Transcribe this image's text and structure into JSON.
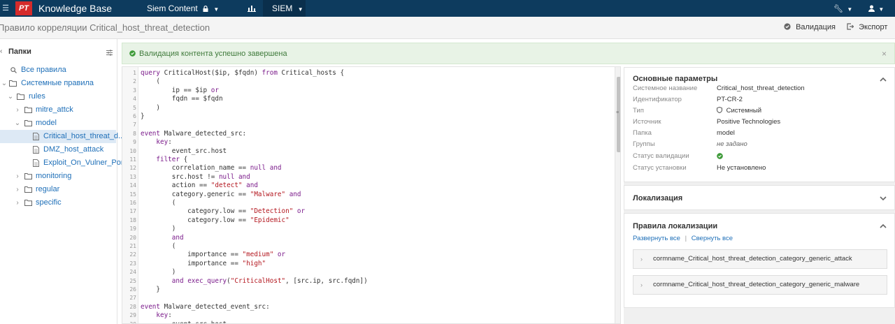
{
  "topbar": {
    "menu_icon": "hamburger-icon",
    "logo_text": "PT",
    "brand": "Knowledge Base",
    "nav_siem_content": "Siem Content",
    "nav_siem": "SIEM",
    "colors": {
      "bg": "#0d3b5e",
      "logo": "#d52b2b"
    }
  },
  "titlebar": {
    "title": "Правило корреляции Critical_host_threat_detection",
    "validate_label": "Валидация",
    "export_label": "Экспорт"
  },
  "sidebar": {
    "title": "Папки",
    "items": [
      {
        "label": "Все правила"
      },
      {
        "label": "Системные правила"
      },
      {
        "label": "rules"
      },
      {
        "label": "mitre_attck"
      },
      {
        "label": "model"
      },
      {
        "label": "Critical_host_threat_d..."
      },
      {
        "label": "DMZ_host_attack"
      },
      {
        "label": "Exploit_On_Vulner_Port"
      },
      {
        "label": "monitoring"
      },
      {
        "label": "regular"
      },
      {
        "label": "specific"
      }
    ]
  },
  "alert": {
    "text": "Валидация контента успешно завершена",
    "close": "×"
  },
  "editor": {
    "line_numbers": [
      "1",
      "2",
      "3",
      "4",
      "5",
      "6",
      "7",
      "8",
      "9",
      "10",
      "11",
      "12",
      "13",
      "14",
      "15",
      "16",
      "17",
      "18",
      "19",
      "20",
      "21",
      "22",
      "23",
      "24",
      "25",
      "26",
      "27",
      "28",
      "29",
      "30"
    ]
  },
  "params": {
    "title": "Основные параметры",
    "rows": [
      {
        "label": "Системное название",
        "value": "Critical_host_threat_detection"
      },
      {
        "label": "Идентификатор",
        "value": "PT-CR-2"
      },
      {
        "label": "Тип",
        "value": "Системный"
      },
      {
        "label": "Источник",
        "value": "Positive Technologies"
      },
      {
        "label": "Папка",
        "value": "model"
      },
      {
        "label": "Группы",
        "value": "не задано"
      },
      {
        "label": "Статус валидации",
        "value": ""
      },
      {
        "label": "Статус установки",
        "value": "Не установлено"
      }
    ]
  },
  "localization": {
    "title": "Локализация"
  },
  "loc_rules": {
    "title": "Правила локализации",
    "expand_all": "Развернуть все",
    "separator": "|",
    "collapse_all": "Свернуть все",
    "items": [
      {
        "label": "cormname_Critical_host_threat_detection_category_generic_attack"
      },
      {
        "label": "cormname_Critical_host_threat_detection_category_generic_malware"
      }
    ]
  }
}
